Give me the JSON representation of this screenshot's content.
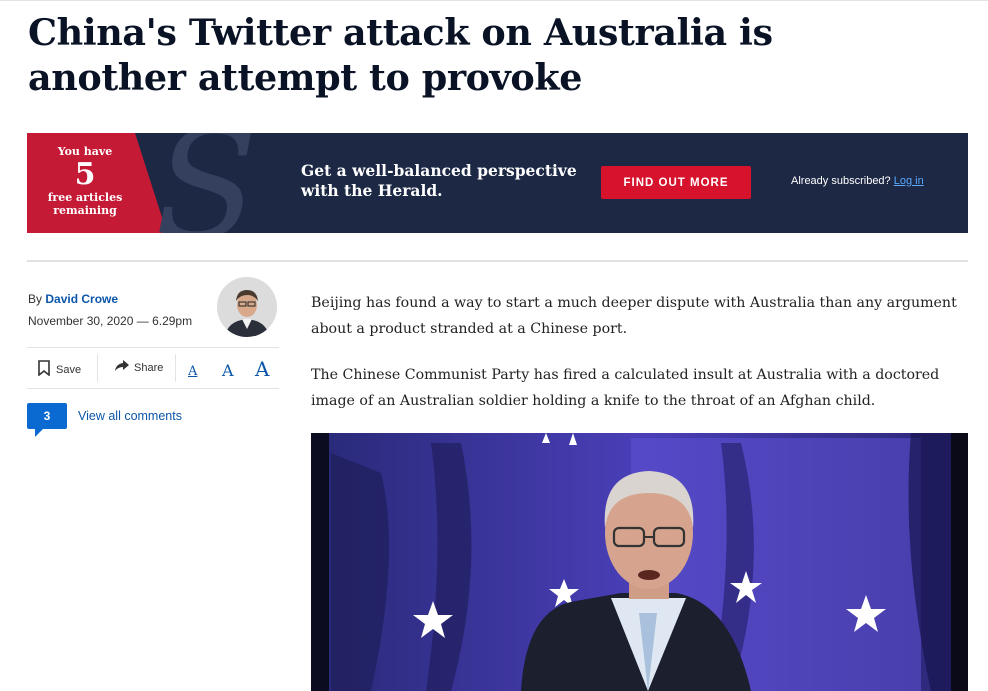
{
  "article": {
    "headline": "China's Twitter attack on Australia is another attempt to provoke",
    "byline_prefix": "By",
    "author": "David Crowe",
    "date": "November 30, 2020 — 6.29pm",
    "paragraphs": [
      "Beijing has found a way to start a much deeper dispute with Australia than any argument about a product stranded at a Chinese port.",
      "The Chinese Communist Party has fired a calculated insult at Australia with a doctored image of an Australian soldier holding a knife to the throat of an Afghan child."
    ]
  },
  "banner": {
    "you_have": "You have",
    "count": "5",
    "free_articles": "free articles",
    "remaining": "remaining",
    "text": "Get a well-balanced perspective with the Herald.",
    "cta": "FIND OUT MORE",
    "already": "Already subscribed?",
    "login": "Log in",
    "colors": {
      "navy": "#1d2845",
      "red": "#c51a36",
      "button": "#d6122c"
    }
  },
  "toolbar": {
    "save": "Save",
    "share": "Share",
    "font_small": "A",
    "font_medium": "A",
    "font_large": "A"
  },
  "comments": {
    "count": "3",
    "label": "View all comments"
  },
  "icons": {
    "save": "bookmark-icon",
    "share": "share-arrow-icon",
    "comments": "comment-bubble-icon"
  }
}
